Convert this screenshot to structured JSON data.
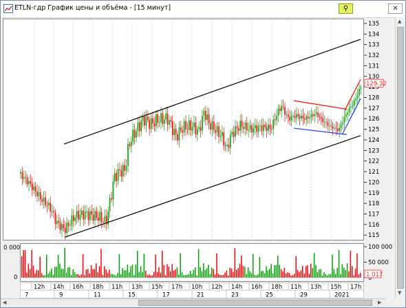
{
  "window": {
    "title": "ETLN-гдр График цены и объёма - [15 минут]",
    "pin_icon": "pin-icon",
    "close_icon": "close-icon",
    "close_glyph": "✕",
    "pin_glyph": "⚲"
  },
  "price_chart": {
    "y_ticks": [
      "135",
      "134",
      "133",
      "132",
      "131",
      "130",
      "129",
      "128",
      "127",
      "126",
      "125",
      "124",
      "123",
      "122",
      "121",
      "120",
      "119",
      "118",
      "117",
      "116",
      "115"
    ],
    "last_price": "129.32",
    "last_price_color": "#ff2a2a"
  },
  "volume_chart": {
    "left_top_label": "0 000",
    "left_bottom_label": "0",
    "right_ticks": [
      "100 000",
      "50 000",
      "0"
    ],
    "last_volume": "1 017",
    "up_color": "#00a000",
    "down_color": "#ff0000"
  },
  "time_axis": {
    "hours": [
      "12h",
      "14h",
      "16h",
      "18h",
      "11h",
      "13h",
      "15h",
      "17h",
      "10h",
      "12h",
      "14h",
      "16h",
      "18h",
      "11h",
      "13h",
      "15h",
      "17h"
    ],
    "days": [
      "7",
      "9",
      "11",
      "15",
      "17",
      "21",
      "23",
      "25",
      "29",
      "2021"
    ]
  },
  "colors": {
    "channel_lines": "#000000",
    "red_trend": "#ff0000",
    "blue_trend": "#1a33ff"
  }
}
